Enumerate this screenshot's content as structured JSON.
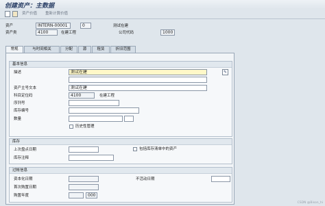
{
  "window": {
    "title": "创建资产：主数据"
  },
  "toolbar": {
    "asset_value_label": "资产价值",
    "recalc_value_label": "重新计算价值",
    "icons": [
      "new-doc-icon",
      "copy-doc-icon"
    ]
  },
  "header": {
    "asset_label": "资产",
    "asset_value": "INTERN-00001",
    "sub_value": "0",
    "asset_desc": "测试在建",
    "class_label": "资产类",
    "class_value": "4100",
    "class_desc": "在建工程",
    "company_label": "公司代码",
    "company_value": "1000"
  },
  "tabs": [
    {
      "label": "常规",
      "active": true
    },
    {
      "label": "与时间相关",
      "active": false
    },
    {
      "label": "分配",
      "active": false
    },
    {
      "label": "源",
      "active": false
    },
    {
      "label": "租赁",
      "active": false
    },
    {
      "label": "折旧范围",
      "active": false
    }
  ],
  "basic_info": {
    "title": "基本信息",
    "desc_label": "描述",
    "desc_value": "测试在建",
    "desc2_value": "",
    "main_text_label": "资产主号文本",
    "main_text_value": "测试在建",
    "account_det_label": "科目定位码",
    "account_det_value": "4100",
    "account_det_desc": "在建工程",
    "serial_label": "序列号",
    "serial_value": "",
    "inventory_label": "库存编号",
    "inventory_value": "",
    "quantity_label": "数量",
    "quantity_value": "",
    "quantity_unit": "",
    "history_label": "历史性管理",
    "history_checked": false
  },
  "inventory": {
    "title": "库存",
    "last_count_label": "上次盘点日期",
    "last_count_value": "",
    "include_label": "包括库存清单中的资产",
    "include_checked": false,
    "note_label": "库存注释",
    "note_value": ""
  },
  "posting_info": {
    "title": "过帐信息",
    "cap_date_label": "资本化日期",
    "cap_date_value": "",
    "deact_label": "不活动日期",
    "deact_value": "",
    "first_acq_label": "首次购置日期",
    "first_acq_value": "",
    "acq_year_label": "购置年度",
    "acq_year_value": "",
    "acq_period_value": "000"
  },
  "watermark": "CSDN @Bison_hi"
}
